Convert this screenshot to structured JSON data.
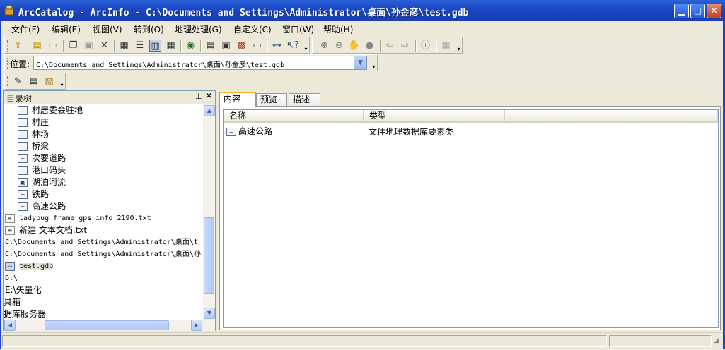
{
  "window": {
    "title": "ArcCatalog - ArcInfo - C:\\Documents and Settings\\Administrator\\桌面\\孙金彦\\test.gdb"
  },
  "menu": [
    "文件(F)",
    "编辑(E)",
    "视图(V)",
    "转到(O)",
    "地理处理(G)",
    "自定义(C)",
    "窗口(W)",
    "帮助(H)"
  ],
  "location": {
    "label": "位置:",
    "value": "C:\\Documents and Settings\\Administrator\\桌面\\孙金彦\\test.gdb"
  },
  "catalog_tree": {
    "title": "目录树",
    "items": [
      {
        "label": "村居委会驻地",
        "icon": "point-feature-icon"
      },
      {
        "label": "村庄",
        "icon": "point-feature-icon"
      },
      {
        "label": "林场",
        "icon": "point-feature-icon"
      },
      {
        "label": "桥梁",
        "icon": "point-feature-icon"
      },
      {
        "label": "次要道路",
        "icon": "line-feature-icon"
      },
      {
        "label": "港口码头",
        "icon": "point-feature-icon"
      },
      {
        "label": "湖泊河流",
        "icon": "polygon-feature-icon"
      },
      {
        "label": "铁路",
        "icon": "line-feature-icon"
      },
      {
        "label": "高速公路",
        "icon": "line-feature-icon"
      },
      {
        "label": "ladybug_frame_gps_info_2190.txt",
        "icon": "text-file-icon"
      },
      {
        "label": "新建 文本文档.txt",
        "icon": "text-file-icon"
      },
      {
        "label": "C:\\Documents and Settings\\Administrator\\桌面\\t",
        "icon": ""
      },
      {
        "label": "C:\\Documents and Settings\\Administrator\\桌面\\孙",
        "icon": ""
      },
      {
        "label": "test.gdb",
        "icon": "geodatabase-icon"
      },
      {
        "label": "D:\\",
        "icon": ""
      },
      {
        "label": "E:\\矢量化",
        "icon": ""
      },
      {
        "label": "具箱",
        "icon": ""
      },
      {
        "label": "据库服务器",
        "icon": ""
      }
    ]
  },
  "tabs": [
    "内容",
    "预览",
    "描述"
  ],
  "contents": {
    "columns": [
      "名称",
      "类型"
    ],
    "rows": [
      {
        "name": "高速公路",
        "type": "文件地理数据库要素类",
        "icon": "line-feature-icon"
      }
    ]
  }
}
